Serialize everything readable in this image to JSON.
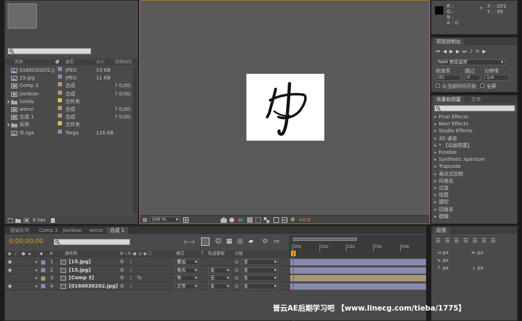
{
  "info": {
    "r_label": "R :",
    "g_label": "G :",
    "b_label": "B :",
    "a_label": "A : 0",
    "x_coord": "X : -201",
    "y_coord": "Y : -39"
  },
  "preview": {
    "title": "预览控制台",
    "ram_option": "RAM 预览选项",
    "frame_rate_label": "帧速率",
    "skip_label": "跳过",
    "resolution_label": "分辨率",
    "frame_rate_value": "(0)",
    "skip_value": "0",
    "resolution_value": "1/4",
    "from_current_label": "从当前时间开始",
    "fullscreen_label": "全屏"
  },
  "effects": {
    "tab_active": "效果和预置",
    "tab_inactive": "文字",
    "items": [
      "Final Effects",
      "Next Effects",
      "Studio Effects",
      "3D 通道",
      "* 【动画预置】",
      "Freebie",
      "Synthetic Aperture",
      "Trapcode",
      "表达式控制",
      "风格化",
      "过渡",
      "绘图",
      "键控",
      "旧版本",
      "模糊"
    ]
  },
  "project": {
    "col_name": "名称",
    "col_type": "类型",
    "col_size": "大小",
    "col_duration": "持续时间",
    "bpc": "8 bpc",
    "items": [
      {
        "name": "0160030202.jpg",
        "type": "JPEG",
        "size": "53 KB",
        "dur": "",
        "color": "#8a8ab0",
        "icon": "image"
      },
      {
        "name": "15.jpg",
        "type": "JPEG",
        "size": "11 KB",
        "dur": "",
        "color": "#8a8ab0",
        "icon": "image"
      },
      {
        "name": "Comp 3",
        "type": "合成",
        "size": "",
        "dur": "? 0;00;",
        "color": "#a89878",
        "icon": "comp"
      },
      {
        "name": "jianbian",
        "type": "合成",
        "size": "",
        "dur": "? 0;00;",
        "color": "#a89878",
        "icon": "comp"
      },
      {
        "name": "Solids",
        "type": "文件夹",
        "size": "",
        "dur": "",
        "color": "#d8c040",
        "icon": "folder"
      },
      {
        "name": "wenzi",
        "type": "合成",
        "size": "",
        "dur": "? 0;00;",
        "color": "#a89878",
        "icon": "comp"
      },
      {
        "name": "合成 1",
        "type": "合成",
        "size": "",
        "dur": "? 0;00;",
        "color": "#a89878",
        "icon": "comp"
      },
      {
        "name": "实体",
        "type": "文件夹",
        "size": "",
        "dur": "",
        "color": "#d8c040",
        "icon": "folder"
      },
      {
        "name": "中.tga",
        "type": "Targa",
        "size": "116 KB",
        "dur": "",
        "color": "#8a8ab0",
        "icon": "image"
      }
    ]
  },
  "viewer": {
    "zoom": "100 %",
    "exposure": "+0.0"
  },
  "timeline_tabs": [
    "渲染队列",
    "Comp 3",
    "jianbian",
    "wenzi",
    "合成 1"
  ],
  "timeline": {
    "timecode": "0;00;00;00",
    "col_source": "源名称",
    "col_mode": "模式",
    "col_t": "T",
    "col_trkmat": "轨道蒙板",
    "col_parent": "父级",
    "ruler": [
      "00s",
      "02s",
      "02s",
      "03s",
      "04s"
    ],
    "layers": [
      {
        "num": "1",
        "name": "[15.jpg]",
        "mode": "叠加",
        "trk": "",
        "parent": "无",
        "color": "#8a8ab0",
        "eye": true
      },
      {
        "num": "2",
        "name": "[15.jpg]",
        "mode": "柔光",
        "trk": "无",
        "parent": "无",
        "color": "#8a8ab0",
        "eye": true
      },
      {
        "num": "3",
        "name": "[Comp 3]",
        "mode": "亮",
        "trk": "无",
        "parent": "无",
        "color": "#a89878",
        "eye": false
      },
      {
        "num": "4",
        "name": "[0160030202.jpg]",
        "mode": "正常",
        "trk": "无",
        "parent": "无",
        "color": "#8a8ab0",
        "eye": true
      }
    ]
  },
  "paragraph": {
    "title": "段落",
    "px": "px"
  },
  "watermark": "晋云AE后期学习吧 【www.linecg.com/tieba/1775】"
}
